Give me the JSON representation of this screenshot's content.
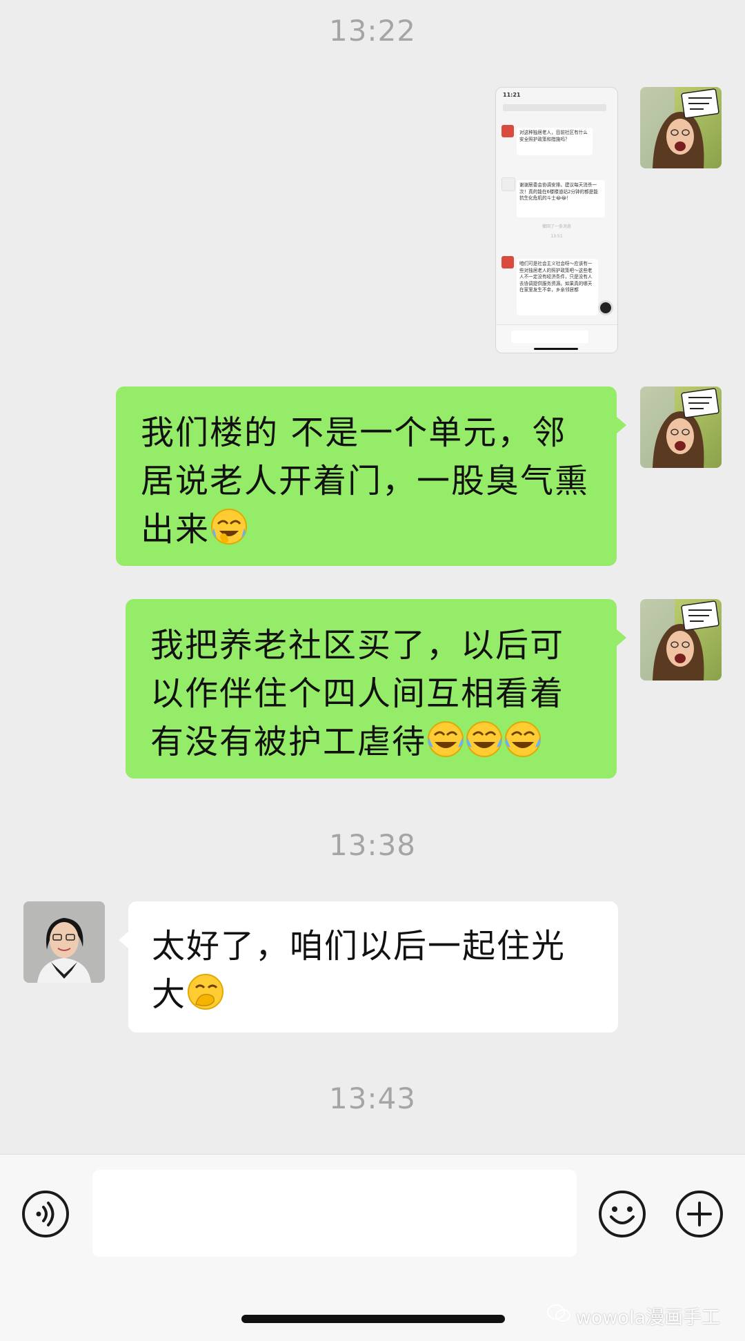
{
  "timestamps": [
    "13:22",
    "13:38",
    "13:43"
  ],
  "messages": [
    {
      "side": "right",
      "type": "image",
      "text": ""
    },
    {
      "side": "right",
      "type": "text",
      "text": "我们楼的 不是一个单元，邻居说老人开着门，一股臭气熏出来",
      "emojis": [
        "face-with-tears-of-joy-covering"
      ]
    },
    {
      "side": "right",
      "type": "text",
      "text": "我把养老社区买了，以后可以作伴住个四人间互相看着有没有被护工虐待",
      "emojis": [
        "face-with-tears-of-joy",
        "face-with-tears-of-joy",
        "face-with-tears-of-joy"
      ]
    },
    {
      "side": "left",
      "type": "text",
      "text": "太好了，咱们以后一起住光大",
      "emojis": [
        "face-with-hand-over-mouth"
      ]
    }
  ],
  "avatar_bubble_text": "富婆陪养 问我呀！",
  "thumbnail": {
    "status_time": "11:21",
    "bubbles": [
      "对这种独居老人，目前社区有什么安全照护政策和措施吗？",
      "谢谢居委会协调安排。建议每天消杀一次！真的能在6楼楼道站2分钟的都是能抗生化危机的斗士😂😂！",
      "咱们可是社会主义社会呀～应该有一些对独居老人的照护政策吧～这些老人不一定没有经济条件，只是没有人去协调提供服务资源。如果真的哪天在家里发生不幸，乡亲邻居都"
    ],
    "footer_note": "撤回了一条消息",
    "mid_time": "13:51"
  },
  "inputbar": {
    "voice_icon": "voice-icon",
    "emoji_icon": "emoji-icon",
    "plus_icon": "plus-icon",
    "input_value": ""
  },
  "watermark": "wowola漫画手工",
  "colors": {
    "sent_bubble": "#95ec69",
    "received_bubble": "#ffffff",
    "background": "#ededed"
  }
}
